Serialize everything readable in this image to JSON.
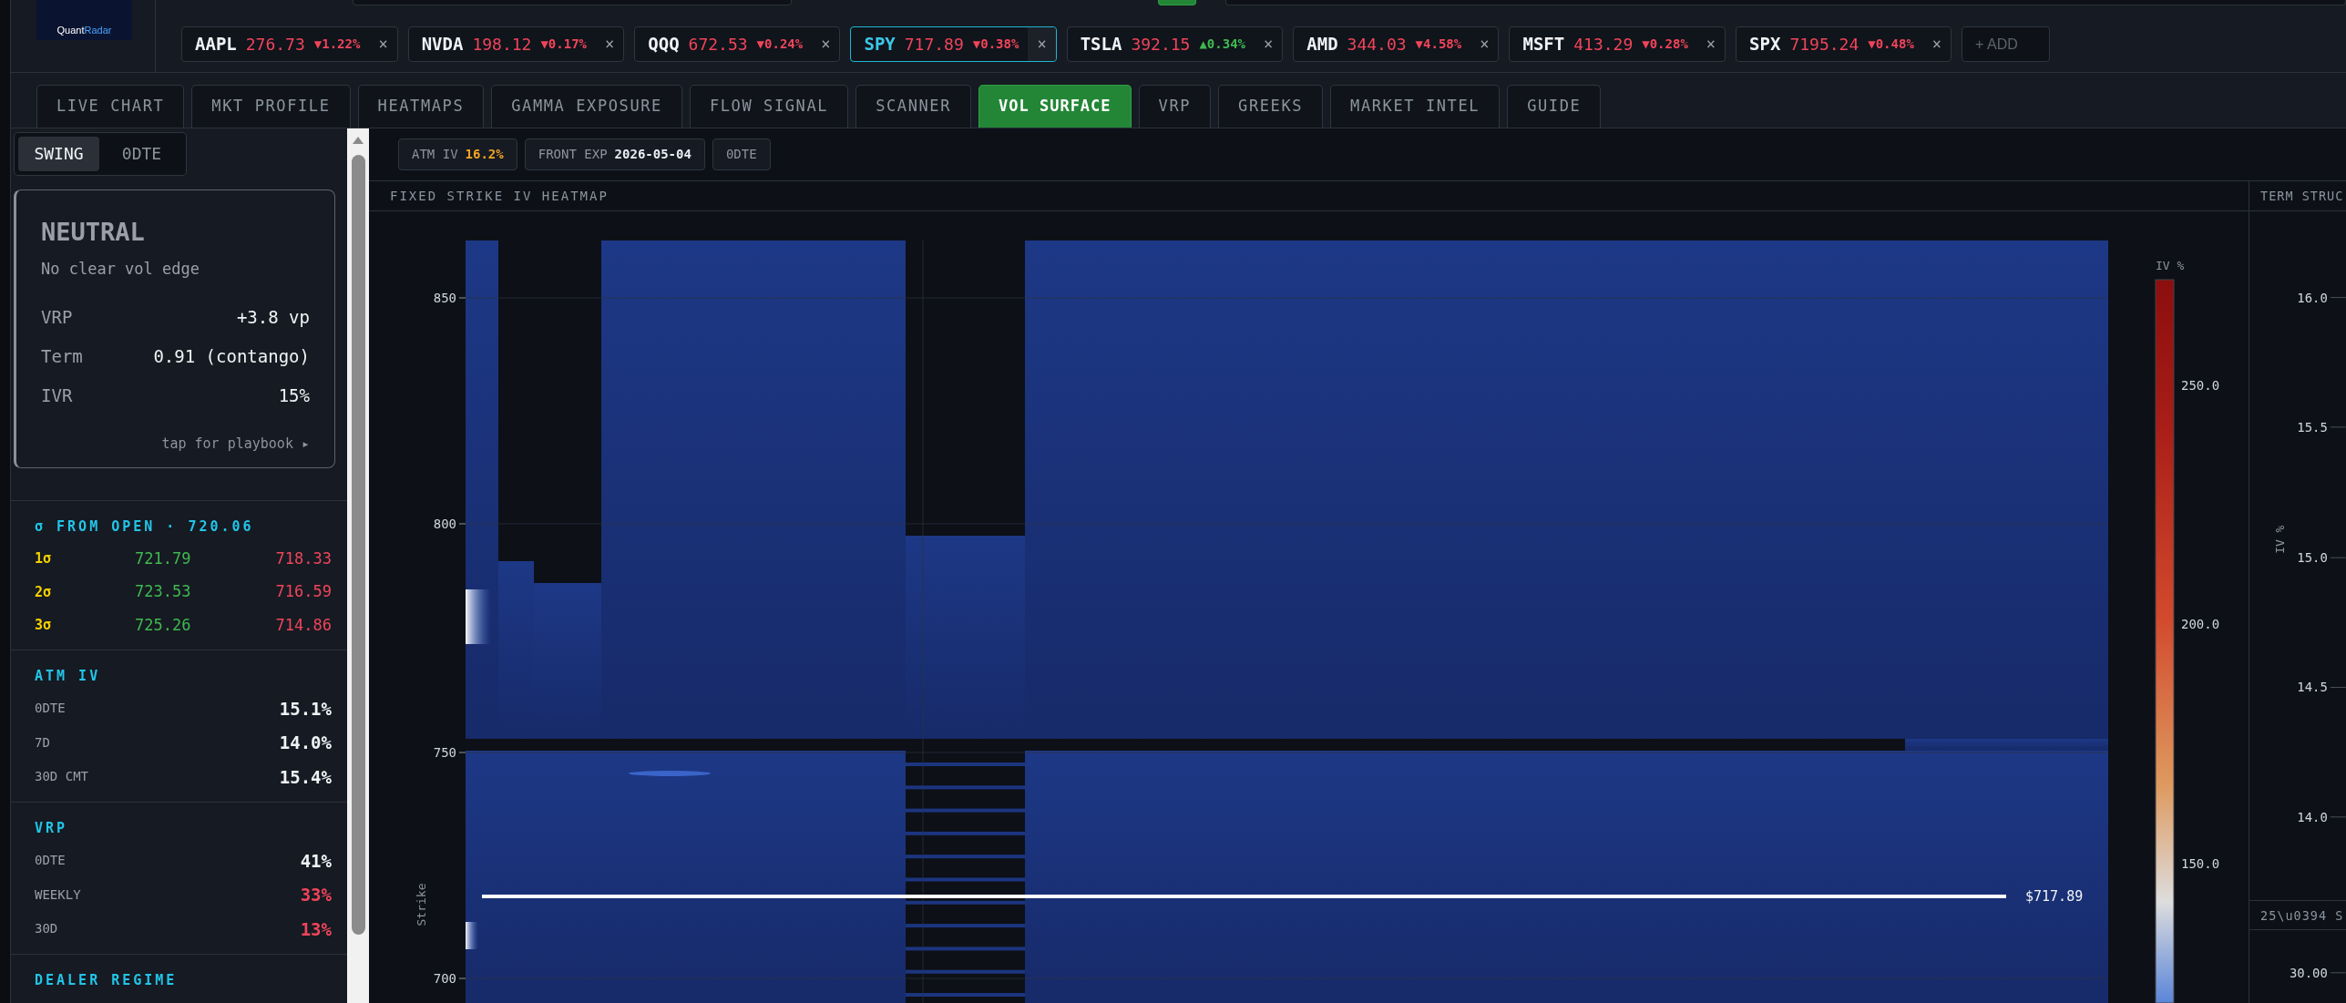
{
  "logo": {
    "part_1": "Quant",
    "part_2": "Radar"
  },
  "tickers": [
    {
      "symbol": "AAPL",
      "price": "276.73",
      "change": "▼1.22%",
      "falling": true,
      "selected": false
    },
    {
      "symbol": "NVDA",
      "price": "198.12",
      "change": "▼0.17%",
      "falling": true,
      "selected": false
    },
    {
      "symbol": "QQQ",
      "price": "672.53",
      "change": "▼0.24%",
      "falling": true,
      "selected": false
    },
    {
      "symbol": "SPY",
      "price": "717.89",
      "change": "▼0.38%",
      "falling": true,
      "selected": true
    },
    {
      "symbol": "TSLA",
      "price": "392.15",
      "change": "▲0.34%",
      "falling": false,
      "selected": false
    },
    {
      "symbol": "AMD",
      "price": "344.03",
      "change": "▼4.58%",
      "falling": true,
      "selected": false
    },
    {
      "symbol": "MSFT",
      "price": "413.29",
      "change": "▼0.28%",
      "falling": true,
      "selected": false
    },
    {
      "symbol": "SPX",
      "price": "7195.24",
      "change": "▼0.48%",
      "falling": true,
      "selected": false
    }
  ],
  "ticker_close": "×",
  "add_button": "+ ADD",
  "tabs": [
    {
      "label": "LIVE CHART",
      "selected": false
    },
    {
      "label": "MKT PROFILE",
      "selected": false
    },
    {
      "label": "HEATMAPS",
      "selected": false
    },
    {
      "label": "GAMMA EXPOSURE",
      "selected": false
    },
    {
      "label": "FLOW SIGNAL",
      "selected": false
    },
    {
      "label": "SCANNER",
      "selected": false
    },
    {
      "label": "VOL SURFACE",
      "selected": true
    },
    {
      "label": "VRP",
      "selected": false
    },
    {
      "label": "GREEKS",
      "selected": false
    },
    {
      "label": "MARKET INTEL",
      "selected": false
    },
    {
      "label": "GUIDE",
      "selected": false
    }
  ],
  "mode_toggle": [
    {
      "label": "SWING",
      "selected": true
    },
    {
      "label": "0DTE",
      "selected": false
    }
  ],
  "signal_card": {
    "title": "NEUTRAL",
    "subtitle": "No clear vol edge",
    "rows": [
      {
        "label": "VRP",
        "value": "+3.8 vp"
      },
      {
        "label": "Term",
        "value": "0.91 (contango)"
      },
      {
        "label": "IVR",
        "value": "15%"
      }
    ],
    "link": "tap for playbook ▸"
  },
  "sigma_section": {
    "title": "σ FROM OPEN · 720.06",
    "rows": [
      {
        "label": "1σ",
        "up": "721.79",
        "down": "718.33"
      },
      {
        "label": "2σ",
        "up": "723.53",
        "down": "716.59"
      },
      {
        "label": "3σ",
        "up": "725.26",
        "down": "714.86"
      }
    ]
  },
  "atm_iv": {
    "title": "ATM IV",
    "rows": [
      {
        "label": "0DTE",
        "value": "15.1%",
        "alert": false
      },
      {
        "label": "7D",
        "value": "14.0%",
        "alert": false
      },
      {
        "label": "30D CMT",
        "value": "15.4%",
        "alert": false
      }
    ]
  },
  "vrp": {
    "title": "VRP",
    "rows": [
      {
        "label": "0DTE",
        "value": "41%",
        "alert": false
      },
      {
        "label": "WEEKLY",
        "value": "33%",
        "alert": true
      },
      {
        "label": "30D",
        "value": "13%",
        "alert": true
      }
    ]
  },
  "dealer_regime": {
    "title": "DEALER REGIME"
  },
  "chips": [
    {
      "label": "ATM IV",
      "value": "16.2%",
      "highlighted": true
    },
    {
      "label": "FRONT EXP",
      "value": "2026-05-04",
      "highlighted": false
    },
    {
      "label": "0DTE"
    }
  ],
  "heatmap": {
    "title": "FIXED STRIKE IV HEATMAP",
    "y_label": "Strike",
    "y_ticks": [
      "850",
      "800",
      "750",
      "700"
    ],
    "spot_label": "$717.89",
    "scale": {
      "title": "IV %",
      "ticks": [
        "250.0",
        "200.0",
        "150.0"
      ]
    }
  },
  "term_panel": {
    "title": "TERM STRUC",
    "y_label": "IV %",
    "y_ticks": [
      "16.0",
      "15.5",
      "15.0",
      "14.5",
      "14.0"
    ]
  },
  "skew_panel": {
    "title": "25\\u0394 S",
    "y_ticks": [
      "30.00"
    ]
  }
}
